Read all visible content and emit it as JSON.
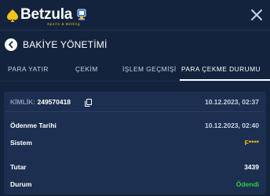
{
  "brand": {
    "name": "Betzula",
    "tagline": "Sports & Betting",
    "accent_color": "#f4c21a"
  },
  "header": {
    "title": "BAKİYE YÖNETİMİ",
    "back_icon": "chevron-left-icon",
    "close_icon": "close-icon"
  },
  "tabs": [
    {
      "label": "PARA YATIR"
    },
    {
      "label": "ÇEKİM"
    },
    {
      "label": "İŞLEM GEÇMİŞİ"
    },
    {
      "label": "PARA ÇEKME DURUMU",
      "active": true
    }
  ],
  "withdrawal": {
    "id_label": "KİMLİK:",
    "id_value": "249570418",
    "created_at": "10.12.2023, 02:37",
    "rows": [
      {
        "label": "Ödenme Tarihi",
        "value": "10.12.2023, 02:40"
      },
      {
        "label": "Sistem",
        "value": "F****"
      },
      {
        "label": "Tutar",
        "value": "3439"
      },
      {
        "label": "Durum",
        "value": "Ödendi"
      }
    ],
    "status_color": "#2ecc40"
  }
}
